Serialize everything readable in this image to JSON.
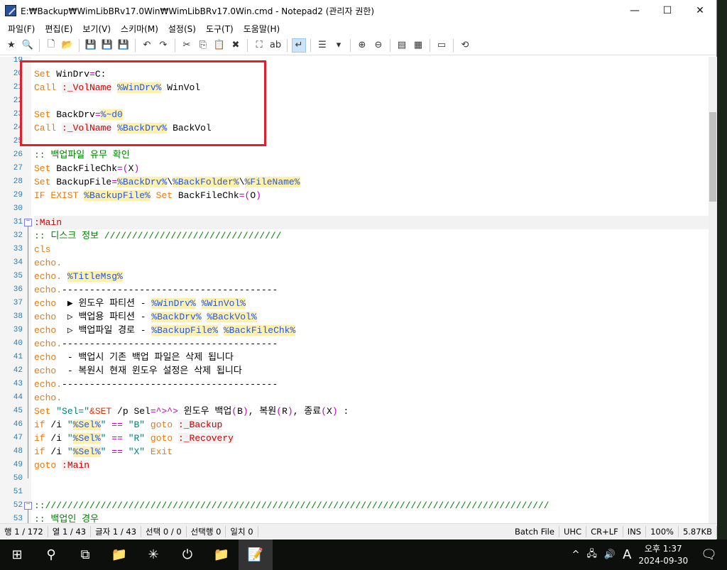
{
  "window": {
    "title": "E:₩Backup₩WimLibBRv17.0Win₩WimLibBRv17.0Win.cmd - Notepad2 (관리자 권한)",
    "minimize": "—",
    "maximize": "☐",
    "close": "✕"
  },
  "menu": [
    "파일(F)",
    "편집(E)",
    "보기(V)",
    "스키마(M)",
    "설정(S)",
    "도구(T)",
    "도움말(H)"
  ],
  "toolbar": [
    {
      "icon": "favorites-icon",
      "g": "★"
    },
    {
      "icon": "find-file-icon",
      "g": "🔍"
    },
    "|",
    {
      "icon": "new-file-icon",
      "g": "🗋"
    },
    {
      "icon": "open-file-icon",
      "g": "📂"
    },
    "|",
    {
      "icon": "save-disabled-icon",
      "g": "💾"
    },
    {
      "icon": "save-icon",
      "g": "💾"
    },
    {
      "icon": "save-all-icon",
      "g": "💾"
    },
    "|",
    {
      "icon": "undo-icon",
      "g": "↶"
    },
    {
      "icon": "redo-icon",
      "g": "↷"
    },
    "|",
    {
      "icon": "cut-icon",
      "g": "✂"
    },
    {
      "icon": "copy-icon",
      "g": "⎘"
    },
    {
      "icon": "paste-icon",
      "g": "📋"
    },
    {
      "icon": "delete-icon",
      "g": "✖"
    },
    "|",
    {
      "icon": "find-icon",
      "g": "⛶"
    },
    {
      "icon": "replace-icon",
      "g": "ab"
    },
    "|",
    {
      "icon": "word-wrap-icon",
      "g": "↵",
      "on": true
    },
    "|",
    {
      "icon": "scheme-icon",
      "g": "☰"
    },
    {
      "icon": "dropdown-icon",
      "g": "▾"
    },
    "|",
    {
      "icon": "zoom-in-icon",
      "g": "⊕"
    },
    {
      "icon": "zoom-out-icon",
      "g": "⊖"
    },
    "|",
    {
      "icon": "scheme-list-icon",
      "g": "▤"
    },
    {
      "icon": "customize-scheme-icon",
      "g": "▦"
    },
    "|",
    {
      "icon": "console-icon",
      "g": "▭"
    },
    "|",
    {
      "icon": "exit-icon",
      "g": "⟲"
    }
  ],
  "colors": {
    "keyword": "#f07800",
    "label": "#d00000",
    "variable": "#2255ee",
    "variable_bg": "#fff1a8",
    "operator": "#c000c0",
    "string": "#008080",
    "comment": "#008000",
    "highlight_box": "#e0202a"
  },
  "editor": {
    "lines": [
      {
        "n": "19",
        "t": []
      },
      {
        "n": "20",
        "t": [
          [
            "kw",
            "Set"
          ],
          [
            "txt",
            " WinDrv"
          ],
          [
            "op",
            "="
          ],
          [
            "txt",
            "C:"
          ]
        ]
      },
      {
        "n": "21",
        "t": [
          [
            "kw",
            "Call"
          ],
          [
            "txt",
            " "
          ],
          [
            "lbl",
            ":_VolName"
          ],
          [
            "txt",
            " "
          ],
          [
            "var",
            "%WinDrv%"
          ],
          [
            "txt",
            " WinVol"
          ]
        ]
      },
      {
        "n": "22",
        "t": []
      },
      {
        "n": "23",
        "t": [
          [
            "kw",
            "Set"
          ],
          [
            "txt",
            " BackDrv"
          ],
          [
            "op",
            "="
          ],
          [
            "var",
            "%~d0"
          ]
        ]
      },
      {
        "n": "24",
        "t": [
          [
            "kw",
            "Call"
          ],
          [
            "txt",
            " "
          ],
          [
            "lbl",
            ":_VolName"
          ],
          [
            "txt",
            " "
          ],
          [
            "var",
            "%BackDrv%"
          ],
          [
            "txt",
            " BackVol"
          ]
        ]
      },
      {
        "n": "25",
        "t": []
      },
      {
        "n": "26",
        "t": [
          [
            "com",
            ":: 백업파일 유무 확인"
          ]
        ]
      },
      {
        "n": "27",
        "t": [
          [
            "kw",
            "Set"
          ],
          [
            "txt",
            " BackFileChk"
          ],
          [
            "op",
            "=("
          ],
          [
            "txt",
            "X"
          ],
          [
            "op",
            ")"
          ]
        ]
      },
      {
        "n": "28",
        "t": [
          [
            "kw",
            "Set"
          ],
          [
            "txt",
            " BackupFile"
          ],
          [
            "op",
            "="
          ],
          [
            "var",
            "%BackDrv%"
          ],
          [
            "txt",
            "\\"
          ],
          [
            "var",
            "%BackFolder%"
          ],
          [
            "txt",
            "\\"
          ],
          [
            "var",
            "%FileName%"
          ]
        ]
      },
      {
        "n": "29",
        "t": [
          [
            "kw",
            "IF EXIST"
          ],
          [
            "txt",
            " "
          ],
          [
            "var",
            "%BackupFile%"
          ],
          [
            "txt",
            " "
          ],
          [
            "kw",
            "Set"
          ],
          [
            "txt",
            " BackFileChk"
          ],
          [
            "op",
            "=("
          ],
          [
            "txt",
            "O"
          ],
          [
            "op",
            ")"
          ]
        ]
      },
      {
        "n": "30",
        "t": []
      },
      {
        "n": "31",
        "t": [
          [
            "lbl",
            ":Main"
          ]
        ],
        "fold": true,
        "cur": true
      },
      {
        "n": "32",
        "t": [
          [
            "com",
            ":: 디스크 정보 ////////////////////////////////"
          ]
        ]
      },
      {
        "n": "33",
        "t": [
          [
            "kw",
            "cls"
          ]
        ]
      },
      {
        "n": "34",
        "t": [
          [
            "kw",
            "echo."
          ]
        ]
      },
      {
        "n": "35",
        "t": [
          [
            "kw",
            "echo."
          ],
          [
            "txt",
            " "
          ],
          [
            "var",
            "%TitleMsg%"
          ]
        ]
      },
      {
        "n": "36",
        "t": [
          [
            "kw",
            "echo."
          ],
          [
            "txt",
            "---------------------------------------"
          ]
        ]
      },
      {
        "n": "37",
        "t": [
          [
            "kw",
            "echo"
          ],
          [
            "txt",
            "  ▶ 윈도우 파티션 - "
          ],
          [
            "var",
            "%WinDrv%"
          ],
          [
            "txt",
            " "
          ],
          [
            "var",
            "%WinVol%"
          ]
        ]
      },
      {
        "n": "38",
        "t": [
          [
            "kw",
            "echo"
          ],
          [
            "txt",
            "  ▷ 백업용 파티션 - "
          ],
          [
            "var",
            "%BackDrv%"
          ],
          [
            "txt",
            " "
          ],
          [
            "var",
            "%BackVol%"
          ]
        ]
      },
      {
        "n": "39",
        "t": [
          [
            "kw",
            "echo"
          ],
          [
            "txt",
            "  ▷ 백업파일 경로 - "
          ],
          [
            "var",
            "%BackupFile%"
          ],
          [
            "txt",
            " "
          ],
          [
            "var",
            "%BackFileChk%"
          ]
        ]
      },
      {
        "n": "40",
        "t": [
          [
            "kw",
            "echo."
          ],
          [
            "txt",
            "---------------------------------------"
          ]
        ]
      },
      {
        "n": "41",
        "t": [
          [
            "kw",
            "echo"
          ],
          [
            "txt",
            "  - 백업시 기존 백업 파일은 삭제 됩니다"
          ]
        ]
      },
      {
        "n": "42",
        "t": [
          [
            "kw",
            "echo"
          ],
          [
            "txt",
            "  - 복원시 현재 윈도우 설정은 삭제 됩니다"
          ]
        ]
      },
      {
        "n": "43",
        "t": [
          [
            "kw",
            "echo."
          ],
          [
            "txt",
            "---------------------------------------"
          ]
        ]
      },
      {
        "n": "44",
        "t": [
          [
            "kw",
            "echo."
          ]
        ]
      },
      {
        "n": "45",
        "t": [
          [
            "kw",
            "Set"
          ],
          [
            "txt",
            " "
          ],
          [
            "str",
            "\"Sel=\""
          ],
          [
            "amp",
            "&SET"
          ],
          [
            "txt",
            " /p Sel"
          ],
          [
            "op",
            "=^>^>"
          ],
          [
            "txt",
            " 윈도우 백업"
          ],
          [
            "op",
            "("
          ],
          [
            "txt",
            "B"
          ],
          [
            "op",
            ")"
          ],
          [
            "txt",
            ", 복원"
          ],
          [
            "op",
            "("
          ],
          [
            "txt",
            "R"
          ],
          [
            "op",
            ")"
          ],
          [
            "txt",
            ", 종료"
          ],
          [
            "op",
            "("
          ],
          [
            "txt",
            "X"
          ],
          [
            "op",
            ")"
          ],
          [
            "txt",
            " :"
          ]
        ]
      },
      {
        "n": "46",
        "t": [
          [
            "kw",
            "if"
          ],
          [
            "txt",
            " /i "
          ],
          [
            "str",
            "\""
          ],
          [
            "var",
            "%Sel%"
          ],
          [
            "str",
            "\""
          ],
          [
            "txt",
            " "
          ],
          [
            "op",
            "=="
          ],
          [
            "txt",
            " "
          ],
          [
            "str",
            "\"B\""
          ],
          [
            "txt",
            " "
          ],
          [
            "kw",
            "goto"
          ],
          [
            "txt",
            " "
          ],
          [
            "lbl",
            ":_Backup"
          ]
        ]
      },
      {
        "n": "47",
        "t": [
          [
            "kw",
            "if"
          ],
          [
            "txt",
            " /i "
          ],
          [
            "str",
            "\""
          ],
          [
            "var",
            "%Sel%"
          ],
          [
            "str",
            "\""
          ],
          [
            "txt",
            " "
          ],
          [
            "op",
            "=="
          ],
          [
            "txt",
            " "
          ],
          [
            "str",
            "\"R\""
          ],
          [
            "txt",
            " "
          ],
          [
            "kw",
            "goto"
          ],
          [
            "txt",
            " "
          ],
          [
            "lbl",
            ":_Recovery"
          ]
        ]
      },
      {
        "n": "48",
        "t": [
          [
            "kw",
            "if"
          ],
          [
            "txt",
            " /i "
          ],
          [
            "str",
            "\""
          ],
          [
            "var",
            "%Sel%"
          ],
          [
            "str",
            "\""
          ],
          [
            "txt",
            " "
          ],
          [
            "op",
            "=="
          ],
          [
            "txt",
            " "
          ],
          [
            "str",
            "\"X\""
          ],
          [
            "txt",
            " "
          ],
          [
            "kw",
            "Exit"
          ]
        ]
      },
      {
        "n": "49",
        "t": [
          [
            "kw",
            "goto"
          ],
          [
            "txt",
            " "
          ],
          [
            "lbl",
            ":Main"
          ]
        ]
      },
      {
        "n": "50",
        "t": []
      },
      {
        "n": "51",
        "t": []
      },
      {
        "n": "52",
        "t": [
          [
            "com",
            "::///////////////////////////////////////////////////////////////////////////////////////////"
          ]
        ],
        "fold": true
      },
      {
        "n": "53",
        "t": [
          [
            "com",
            ":: 백업인 경우"
          ]
        ]
      }
    ]
  },
  "status": {
    "left": [
      "행 1 / 172",
      "열 1 / 43",
      "글자 1 / 43",
      "선택 0 / 0",
      "선택행 0",
      "일치 0"
    ],
    "right": [
      "Batch File",
      "UHC",
      "CR+LF",
      "INS",
      "100%",
      "5.87KB"
    ]
  },
  "taskbar": {
    "items": [
      {
        "icon": "windows-start-icon",
        "g": "⊞"
      },
      {
        "icon": "search-icon",
        "g": "⚲"
      },
      {
        "icon": "task-view-icon",
        "g": "⧉"
      },
      {
        "icon": "file-explorer-icon",
        "g": "📁"
      },
      {
        "icon": "green-app-icon",
        "g": "✳"
      },
      {
        "icon": "red-app-icon",
        "g": "⏻"
      },
      {
        "icon": "file-explorer-icon-2",
        "g": "📁"
      },
      {
        "icon": "notepad2-icon",
        "g": "📝",
        "active": true
      }
    ],
    "tray": {
      "chevron": "^",
      "network": "🖧",
      "volume": "🔊",
      "ime": "A",
      "time": "오후 1:37",
      "date": "2024-09-30",
      "notifications": "🗨"
    }
  }
}
